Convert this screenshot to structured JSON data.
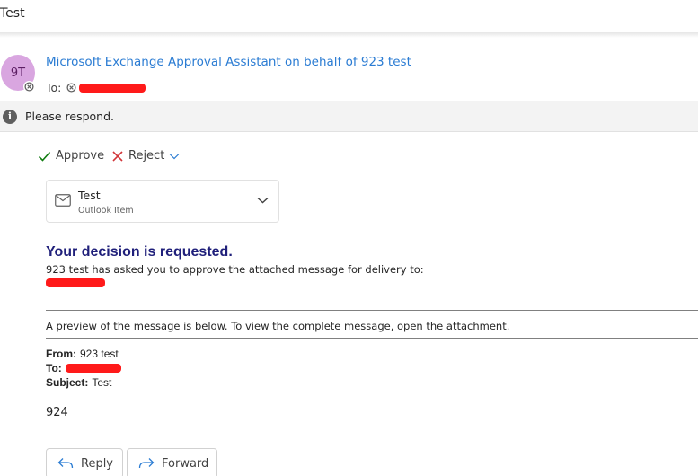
{
  "subject": "Test",
  "sender": {
    "initials": "9T",
    "name": "Microsoft Exchange Approval Assistant on behalf of 923 test",
    "avatar_color": "#d9a6e0"
  },
  "recipients": {
    "to_label": "To:"
  },
  "info_bar": {
    "icon": "info-icon",
    "text": "Please respond."
  },
  "actions": {
    "approve_label": "Approve",
    "reject_label": "Reject",
    "approve_color": "#107c10",
    "reject_color": "#d13438"
  },
  "attachment": {
    "name": "Test",
    "type": "Outlook Item",
    "icon": "mail-icon"
  },
  "decision": {
    "title": "Your decision is requested.",
    "text": "923 test has asked you to approve the attached message for delivery to:"
  },
  "preview": {
    "text": "A preview of the message is below. To view the complete message, open the attachment."
  },
  "message_headers": {
    "from_label": "From:",
    "from_value": "923 test",
    "to_label": "To:",
    "subject_label": "Subject:",
    "subject_value": "Test"
  },
  "message_body": "924",
  "reply_actions": {
    "reply_label": "Reply",
    "forward_label": "Forward"
  },
  "colors": {
    "link": "#2b7cd3",
    "heading": "#1f1f7a",
    "redaction": "#ff1a1a"
  }
}
